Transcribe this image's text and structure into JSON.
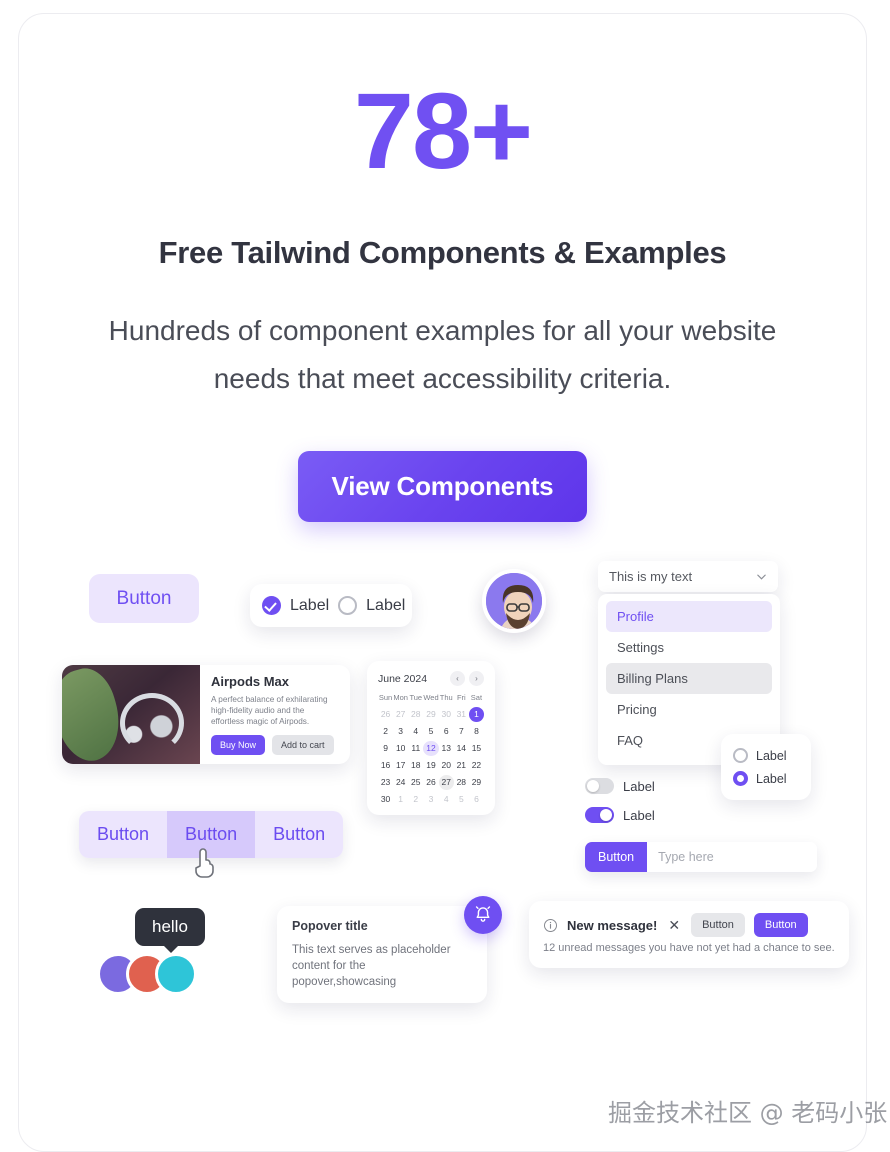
{
  "hero": {
    "count": "78+",
    "title": "Free Tailwind Components & Examples",
    "subtitle": "Hundreds of component examples for all your website needs that meet accessibility criteria.",
    "cta_label": "View Components",
    "accent": "#7050f2",
    "title_color": "#323440"
  },
  "showcase": {
    "pill_button": {
      "label": "Button"
    },
    "checkbox_card": {
      "checked_label": "Label",
      "unchecked_label": "Label"
    },
    "select": {
      "value": "This is my text",
      "chevron": "chevron-down-icon",
      "items": [
        {
          "label": "Profile",
          "state": "selected"
        },
        {
          "label": "Settings",
          "state": "normal"
        },
        {
          "label": "Billing Plans",
          "state": "hovered"
        },
        {
          "label": "Pricing",
          "state": "normal"
        },
        {
          "label": "FAQ",
          "state": "normal"
        }
      ]
    },
    "product": {
      "title": "Airpods Max",
      "description": "A perfect balance of exhilarating high-fidelity audio and the effortless magic of Airpods.",
      "primary_label": "Buy Now",
      "secondary_label": "Add to cart"
    },
    "calendar": {
      "title": "June 2024",
      "prev": "‹",
      "next": "›",
      "dow": [
        "Sun",
        "Mon",
        "Tue",
        "Wed",
        "Thu",
        "Fri",
        "Sat"
      ],
      "days": [
        {
          "n": "26",
          "s": "mut"
        },
        {
          "n": "27",
          "s": "mut"
        },
        {
          "n": "28",
          "s": "mut"
        },
        {
          "n": "29",
          "s": "mut"
        },
        {
          "n": "30",
          "s": "mut"
        },
        {
          "n": "31",
          "s": "mut"
        },
        {
          "n": "1",
          "s": "sel"
        },
        {
          "n": "2",
          "s": ""
        },
        {
          "n": "3",
          "s": ""
        },
        {
          "n": "4",
          "s": ""
        },
        {
          "n": "5",
          "s": ""
        },
        {
          "n": "6",
          "s": ""
        },
        {
          "n": "7",
          "s": ""
        },
        {
          "n": "8",
          "s": ""
        },
        {
          "n": "9",
          "s": ""
        },
        {
          "n": "10",
          "s": ""
        },
        {
          "n": "11",
          "s": ""
        },
        {
          "n": "12",
          "s": "soft"
        },
        {
          "n": "13",
          "s": ""
        },
        {
          "n": "14",
          "s": ""
        },
        {
          "n": "15",
          "s": ""
        },
        {
          "n": "16",
          "s": ""
        },
        {
          "n": "17",
          "s": ""
        },
        {
          "n": "18",
          "s": ""
        },
        {
          "n": "19",
          "s": ""
        },
        {
          "n": "20",
          "s": ""
        },
        {
          "n": "21",
          "s": ""
        },
        {
          "n": "22",
          "s": ""
        },
        {
          "n": "23",
          "s": ""
        },
        {
          "n": "24",
          "s": ""
        },
        {
          "n": "25",
          "s": ""
        },
        {
          "n": "26",
          "s": ""
        },
        {
          "n": "27",
          "s": "grey"
        },
        {
          "n": "28",
          "s": ""
        },
        {
          "n": "29",
          "s": ""
        },
        {
          "n": "30",
          "s": ""
        },
        {
          "n": "1",
          "s": "mut"
        },
        {
          "n": "2",
          "s": "mut"
        },
        {
          "n": "3",
          "s": "mut"
        },
        {
          "n": "4",
          "s": "mut"
        },
        {
          "n": "5",
          "s": "mut"
        },
        {
          "n": "6",
          "s": "mut"
        }
      ]
    },
    "segmented": [
      {
        "label": "Button",
        "active": false
      },
      {
        "label": "Button",
        "active": true
      },
      {
        "label": "Button",
        "active": false
      }
    ],
    "toggles": [
      {
        "label": "Label",
        "on": false
      },
      {
        "label": "Label",
        "on": true
      }
    ],
    "radio_card": [
      {
        "label": "Label",
        "on": false
      },
      {
        "label": "Label",
        "on": true
      }
    ],
    "input_group": {
      "button_label": "Button",
      "placeholder": "Type here",
      "value": ""
    },
    "tooltip": {
      "text": "hello"
    },
    "popover": {
      "title": "Popover title",
      "text": "This text serves as placeholder content for the popover,showcasing"
    },
    "bell": {
      "icon": "bell-icon"
    },
    "alert": {
      "info_icon": "info-circle-icon",
      "title": "New message!",
      "close_icon": "close-icon",
      "body": "12 unread messages you have not yet had a chance to see.",
      "secondary_label": "Button",
      "primary_label": "Button"
    }
  },
  "watermark": {
    "text": "掘金技术社区 @ 老码小张"
  }
}
